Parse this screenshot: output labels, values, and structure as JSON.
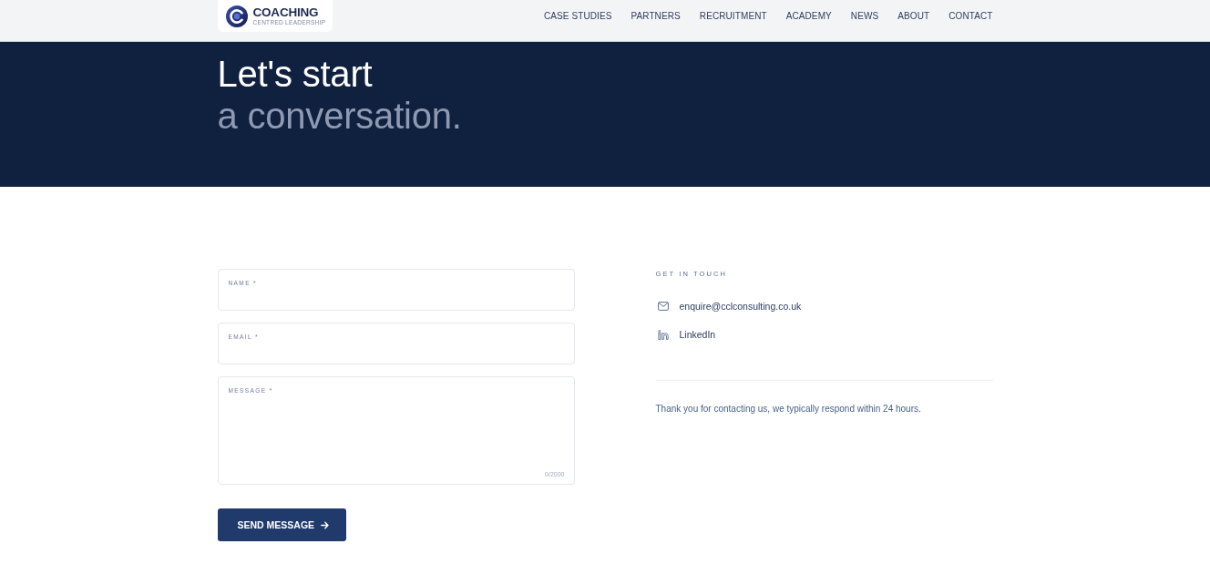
{
  "header": {
    "logo": {
      "name": "COACHING",
      "tagline": "CENTRED LEADERSHIP"
    },
    "nav": [
      "CASE STUDIES",
      "PARTNERS",
      "RECRUITMENT",
      "ACADEMY",
      "NEWS",
      "ABOUT",
      "CONTACT"
    ]
  },
  "hero": {
    "title_line_1": "Let's start",
    "title_line_2": "a conversation."
  },
  "form": {
    "fields": [
      {
        "kind": "text",
        "label": "NAME *"
      },
      {
        "kind": "email",
        "label": "EMAIL *"
      },
      {
        "kind": "textarea",
        "label": "MESSAGE *",
        "counter": "0/2000"
      }
    ],
    "submit": {
      "label": "SEND MESSAGE"
    }
  },
  "contact": {
    "heading": "GET IN TOUCH",
    "links": [
      {
        "kind": "email",
        "label": "enquire@cclconsulting.co.uk"
      },
      {
        "kind": "linkedin",
        "label": "LinkedIn"
      }
    ],
    "note": "Thank you for contacting us, we typically respond within 24 hours."
  }
}
